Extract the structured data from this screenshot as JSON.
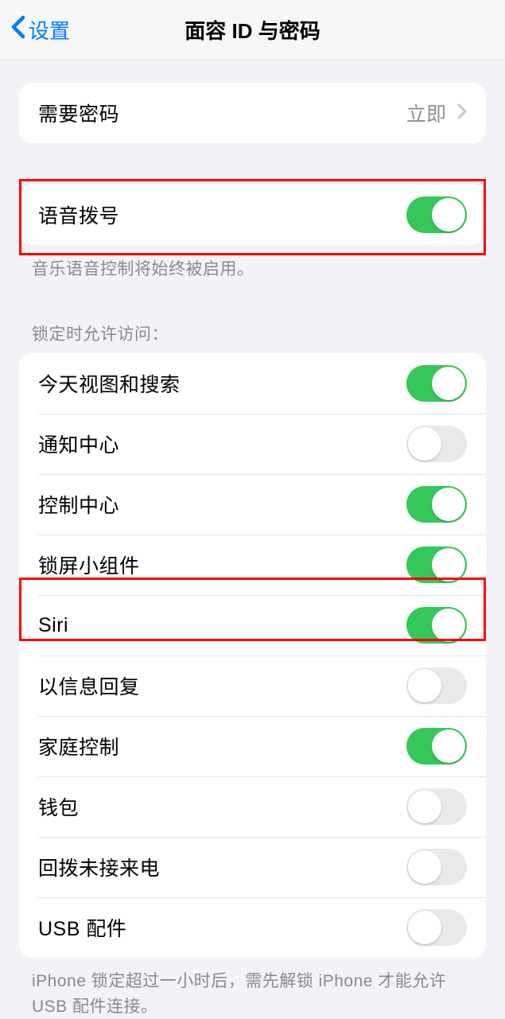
{
  "nav": {
    "back_label": "设置",
    "title": "面容 ID 与密码"
  },
  "require_passcode": {
    "label": "需要密码",
    "value": "立即"
  },
  "voice_dial": {
    "label": "语音拨号",
    "on": true,
    "footer": "音乐语音控制将始终被启用。"
  },
  "lock_access": {
    "header": "锁定时允许访问：",
    "items": [
      {
        "label": "今天视图和搜索",
        "on": true
      },
      {
        "label": "通知中心",
        "on": false
      },
      {
        "label": "控制中心",
        "on": true
      },
      {
        "label": "锁屏小组件",
        "on": true
      },
      {
        "label": "Siri",
        "on": true
      },
      {
        "label": "以信息回复",
        "on": false
      },
      {
        "label": "家庭控制",
        "on": true
      },
      {
        "label": "钱包",
        "on": false
      },
      {
        "label": "回拨未接来电",
        "on": false
      },
      {
        "label": "USB 配件",
        "on": false
      }
    ],
    "footer": "iPhone 锁定超过一小时后，需先解锁 iPhone 才能允许USB 配件连接。"
  }
}
